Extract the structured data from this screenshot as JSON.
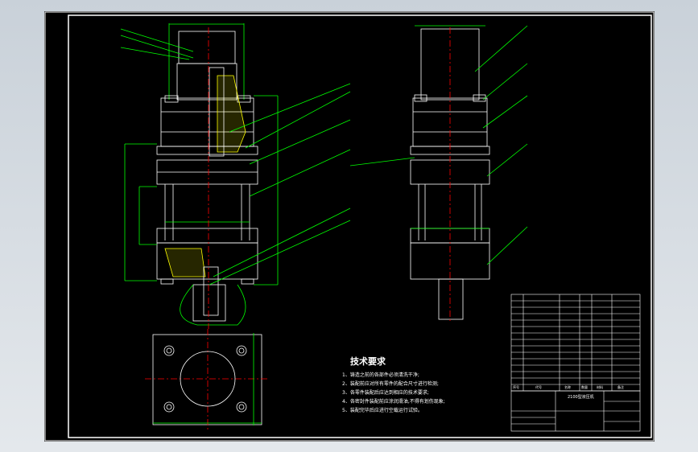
{
  "technical_requirements": {
    "title": "技术要求",
    "items": [
      "1、铸造之前的各部件必须清洗干净;",
      "2、装配前应对所有零件的配合尺寸进行检测;",
      "3、各零件装配后应达到相应的技术要求;",
      "4、各密封件装配前应涂润滑油,不得有划伤现象;",
      "5、装配完毕后应进行空载运行试验。"
    ]
  },
  "title_block": {
    "drawing_name": "2100型液压机",
    "header_row": [
      "序号",
      "代号",
      "名称",
      "数量",
      "材料",
      "备注"
    ]
  },
  "colors": {
    "background": "#000000",
    "outline": "#ffffff",
    "leader": "#00ff00",
    "centerline": "#ff0000",
    "hatch": "#ffff00",
    "viewport": "#d5dbe1"
  }
}
